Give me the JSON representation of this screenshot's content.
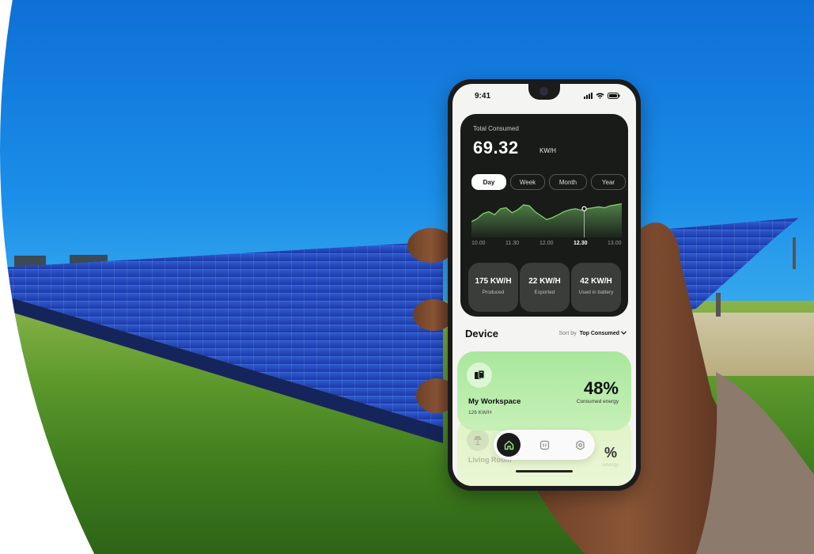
{
  "status_bar": {
    "time": "9:41"
  },
  "summary": {
    "label": "Total Consumed",
    "value": "69.32",
    "unit": "KW/H"
  },
  "tabs": [
    {
      "label": "Day",
      "active": true
    },
    {
      "label": "Week",
      "active": false
    },
    {
      "label": "Month",
      "active": false
    },
    {
      "label": "Year",
      "active": false
    }
  ],
  "chart_data": {
    "type": "area",
    "x": [
      "10.00",
      "11.30",
      "12.00",
      "12.30",
      "13.00"
    ],
    "selected_x": "12.30",
    "values": [
      32,
      38,
      48,
      52,
      46,
      58,
      60,
      50,
      56,
      66,
      64,
      52,
      44,
      36,
      40,
      46,
      52,
      56,
      58,
      55,
      58,
      60,
      62,
      60,
      64,
      66,
      68
    ],
    "title": "",
    "xlabel": "",
    "ylabel": "",
    "grid": false,
    "color": "#7dd06d"
  },
  "stats": [
    {
      "value": "175 KW/H",
      "label": "Produced"
    },
    {
      "value": "22 KW/H",
      "label": "Exported"
    },
    {
      "value": "42 KW/H",
      "label": "Used in battery"
    }
  ],
  "device_section": {
    "title": "Device",
    "sort_label": "Sort by",
    "sort_value": "Top Consumed"
  },
  "devices": [
    {
      "name": "My Workspace",
      "kwh": "126 KW/H",
      "percent": "48%",
      "percent_label": "Consumed energy",
      "icon": "workspace-icon"
    },
    {
      "name": "Living Room",
      "percent": "%",
      "percent_label": "energy",
      "icon": "lamp-icon"
    }
  ],
  "nav": [
    {
      "icon": "home-icon",
      "active": true
    },
    {
      "icon": "devices-icon",
      "active": false
    },
    {
      "icon": "settings-icon",
      "active": false
    }
  ],
  "colors": {
    "dark_card": "#181b18",
    "accent_green": "#a9e79d",
    "sky": "#1a8ee8",
    "grass": "#5f9a2d"
  }
}
